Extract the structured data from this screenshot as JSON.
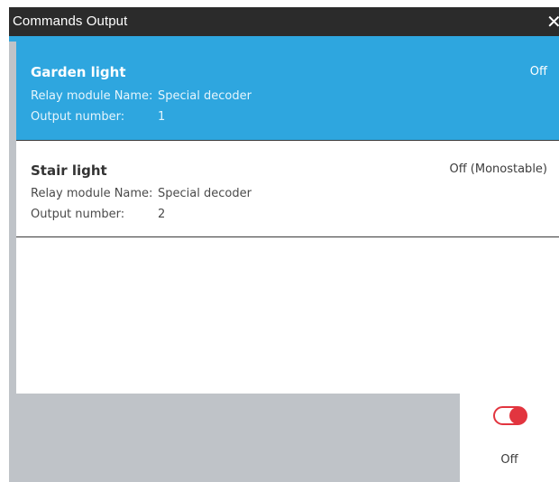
{
  "window": {
    "title": "Commands Output",
    "close_icon": "close-icon",
    "close_glyph": "✕"
  },
  "outputs": [
    {
      "name": "Garden light",
      "status": "Off",
      "relay_label": "Relay module Name:",
      "relay_value": "Special decoder",
      "output_label": "Output number:",
      "output_value": "1",
      "selected": true
    },
    {
      "name": "Stair light",
      "status": "Off (Monostable)",
      "relay_label": "Relay module Name:",
      "relay_value": "Special decoder",
      "output_label": "Output number:",
      "output_value": "2",
      "selected": false
    }
  ],
  "toggle": {
    "state_label": "Off",
    "icon": "toggle-switch-icon",
    "on": false
  },
  "colors": {
    "accent": "#2ea6df",
    "titlebar": "#2b2b2b",
    "background": "#bfc3c8",
    "toggle_off": "#e2353f"
  }
}
